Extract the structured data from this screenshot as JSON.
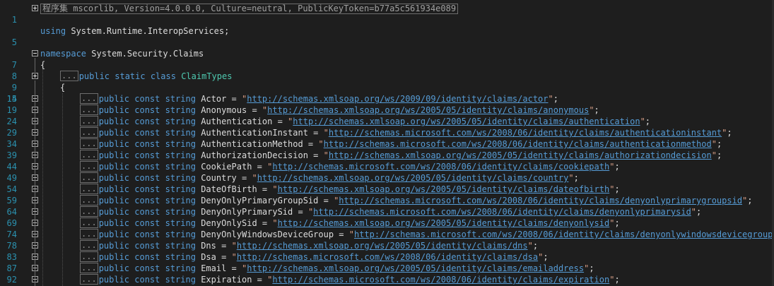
{
  "header": {
    "line_number": "1",
    "assembly_text": "程序集 mscorlib, Version=4.0.0.0, Culture=neutral, PublicKeyToken=b77a5c561934e089"
  },
  "using_line": {
    "line_number": "5",
    "keyword": "using",
    "namespace": "System.Runtime.InteropServices"
  },
  "namespace_line": {
    "line_number": "7",
    "keyword": "namespace",
    "name": "System.Security.Claims"
  },
  "open_brace_line": {
    "line_number": "8",
    "text": "{"
  },
  "class_line": {
    "line_number": "9",
    "ellipsis": "...",
    "keywords": "public static class",
    "class_name": "ClaimTypes"
  },
  "class_brace_line": {
    "line_number": "14",
    "text": "{"
  },
  "const_keywords": "public const string",
  "claims": [
    {
      "line": "15",
      "name": "Actor",
      "url": "http://schemas.xmlsoap.org/ws/2009/09/identity/claims/actor"
    },
    {
      "line": "19",
      "name": "Anonymous",
      "url": "http://schemas.xmlsoap.org/ws/2005/05/identity/claims/anonymous"
    },
    {
      "line": "24",
      "name": "Authentication",
      "url": "http://schemas.xmlsoap.org/ws/2005/05/identity/claims/authentication"
    },
    {
      "line": "29",
      "name": "AuthenticationInstant",
      "url": "http://schemas.microsoft.com/ws/2008/06/identity/claims/authenticationinstant"
    },
    {
      "line": "34",
      "name": "AuthenticationMethod",
      "url": "http://schemas.microsoft.com/ws/2008/06/identity/claims/authenticationmethod"
    },
    {
      "line": "39",
      "name": "AuthorizationDecision",
      "url": "http://schemas.xmlsoap.org/ws/2005/05/identity/claims/authorizationdecision"
    },
    {
      "line": "44",
      "name": "CookiePath",
      "url": "http://schemas.microsoft.com/ws/2008/06/identity/claims/cookiepath"
    },
    {
      "line": "49",
      "name": "Country",
      "url": "http://schemas.xmlsoap.org/ws/2005/05/identity/claims/country"
    },
    {
      "line": "54",
      "name": "DateOfBirth",
      "url": "http://schemas.xmlsoap.org/ws/2005/05/identity/claims/dateofbirth"
    },
    {
      "line": "59",
      "name": "DenyOnlyPrimaryGroupSid",
      "url": "http://schemas.microsoft.com/ws/2008/06/identity/claims/denyonlyprimarygroupsid"
    },
    {
      "line": "64",
      "name": "DenyOnlyPrimarySid",
      "url": "http://schemas.microsoft.com/ws/2008/06/identity/claims/denyonlyprimarysid"
    },
    {
      "line": "69",
      "name": "DenyOnlySid",
      "url": "http://schemas.xmlsoap.org/ws/2005/05/identity/claims/denyonlysid"
    },
    {
      "line": "74",
      "name": "DenyOnlyWindowsDeviceGroup",
      "url": "http://schemas.microsoft.com/ws/2008/06/identity/claims/denyonlywindowsdevicegroup"
    },
    {
      "line": "78",
      "name": "Dns",
      "url": "http://schemas.xmlsoap.org/ws/2005/05/identity/claims/dns"
    },
    {
      "line": "83",
      "name": "Dsa",
      "url": "http://schemas.microsoft.com/ws/2008/06/identity/claims/dsa"
    },
    {
      "line": "87",
      "name": "Email",
      "url": "http://schemas.xmlsoap.org/ws/2005/05/identity/claims/emailaddress"
    },
    {
      "line": "92",
      "name": "Expiration",
      "url": "http://schemas.microsoft.com/ws/2008/06/identity/claims/expiration"
    }
  ],
  "colors": {
    "background": "#1e1e1e",
    "line_number": "#2b91af",
    "keyword": "#569cd6",
    "type": "#4ec9b0",
    "string": "#d69d85",
    "text": "#dcdcdc"
  },
  "icons": {
    "collapsed_fold": "plus-box-icon",
    "expanded_fold": "minus-box-icon"
  }
}
